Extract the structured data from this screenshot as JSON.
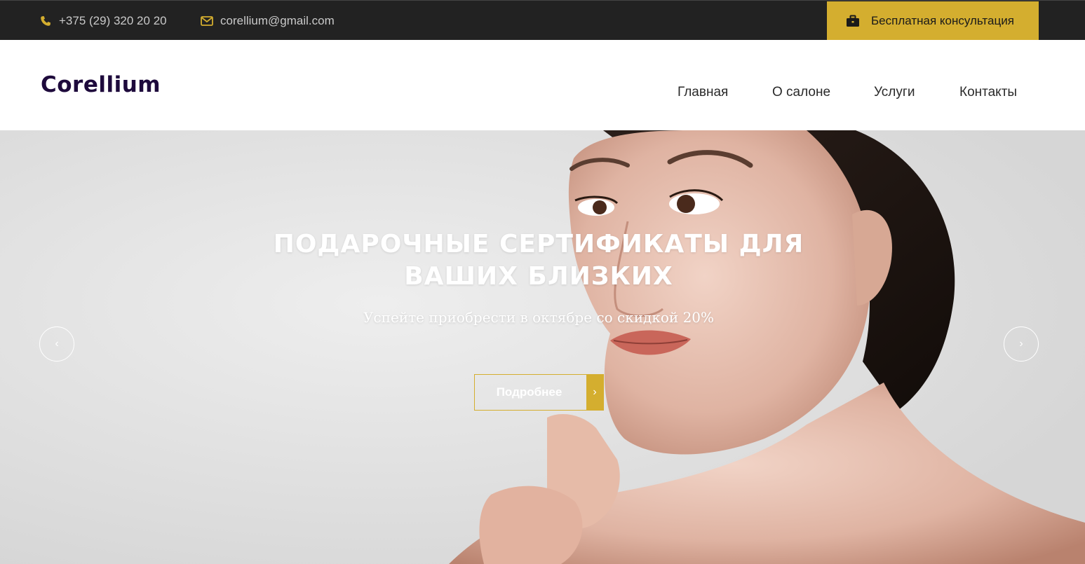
{
  "topbar": {
    "phone": "+375 (29) 320 20 20",
    "phone_icon": "phone-icon",
    "email": "corellium@gmail.com",
    "email_icon": "envelope-icon",
    "consult_button": "Бесплатная консультация",
    "consult_icon": "briefcase-icon",
    "accent_color": "#d4ae2f"
  },
  "header": {
    "logo": "Corellium",
    "nav": [
      "Главная",
      "О салоне",
      "Услуги",
      "Контакты"
    ]
  },
  "hero": {
    "title_line1": "ПОДАРОЧНЫЕ СЕРТИФИКАТЫ ДЛЯ",
    "title_line2": "ВАШИХ БЛИЗКИХ",
    "subtitle": "Успейте приобрести в октябре со скидкой 20%",
    "button_label": "Подробнее",
    "prev_arrow": "‹",
    "next_arrow": "›",
    "button_arrow": "›"
  }
}
